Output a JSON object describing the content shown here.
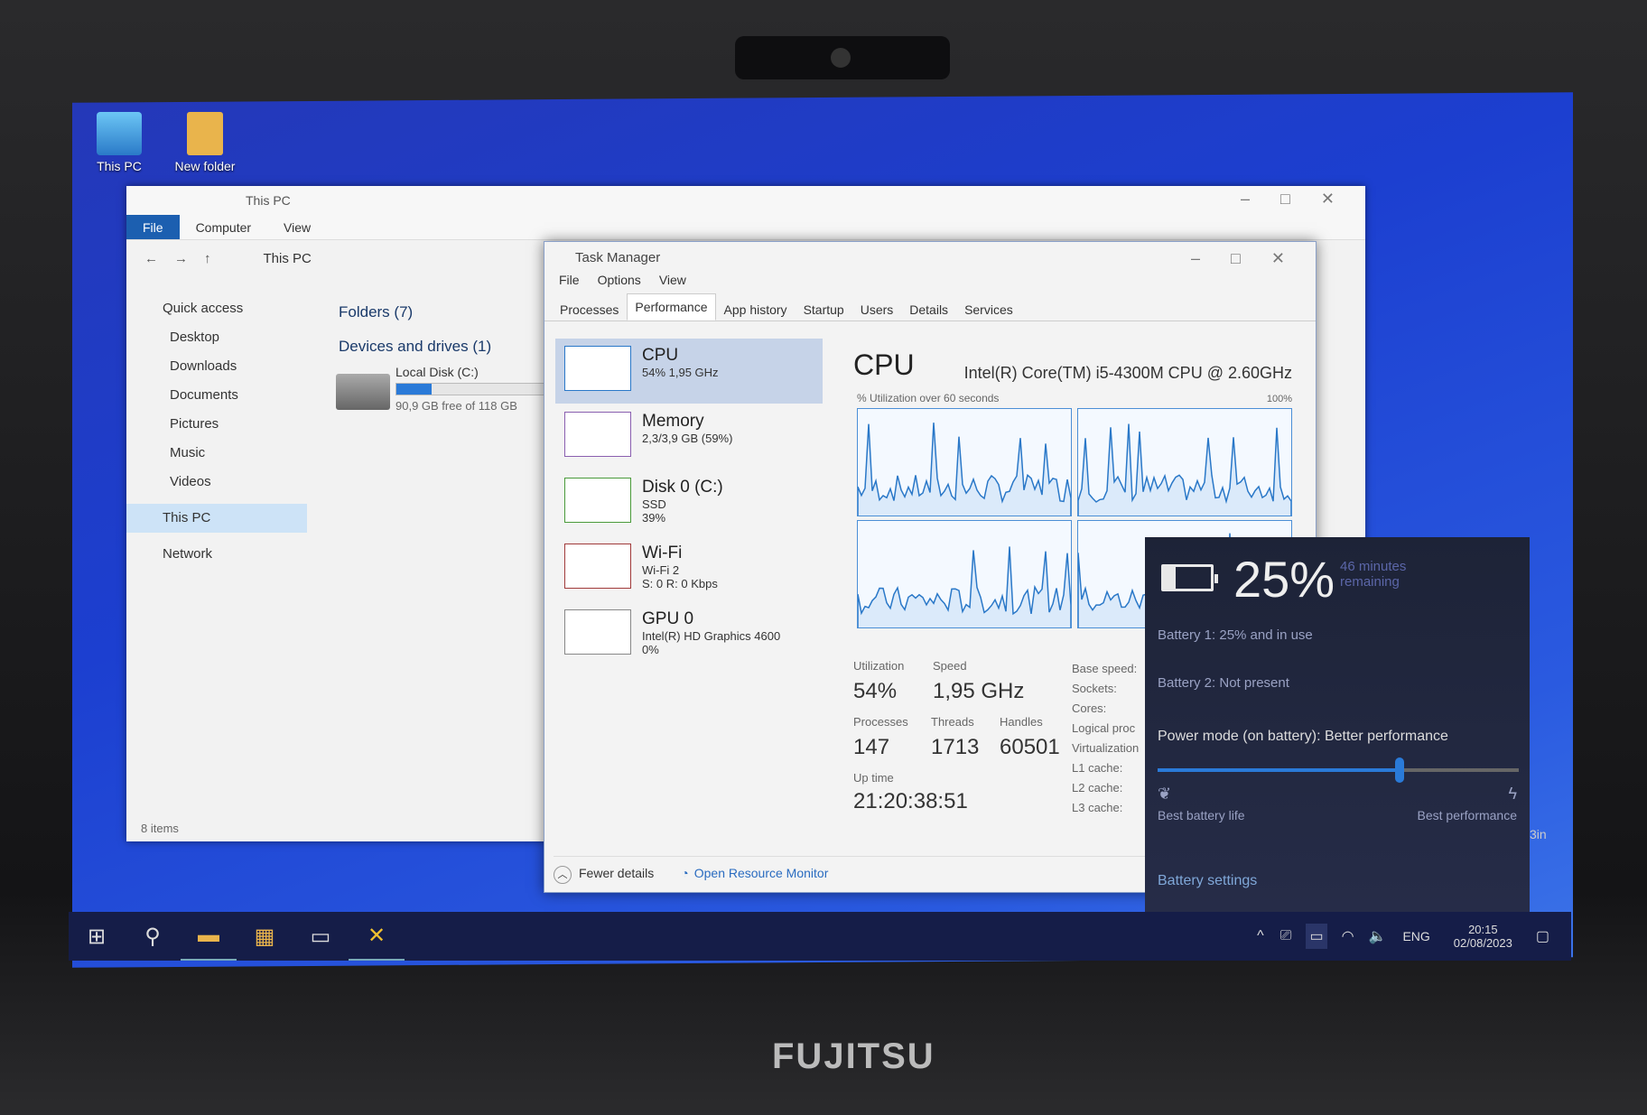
{
  "desktop": {
    "icons": [
      {
        "label": "This PC",
        "icon": "computer-icon"
      },
      {
        "label": "New folder",
        "icon": "folder-icon"
      }
    ]
  },
  "explorer": {
    "title": "This PC",
    "ribbon": [
      "File",
      "Computer",
      "View"
    ],
    "address": "This PC",
    "nav": [
      {
        "label": "Quick access",
        "icon": "star-icon"
      },
      {
        "label": "Desktop",
        "pinned": true
      },
      {
        "label": "Downloads",
        "pinned": true
      },
      {
        "label": "Documents",
        "pinned": true
      },
      {
        "label": "Pictures",
        "pinned": true
      },
      {
        "label": "Music"
      },
      {
        "label": "Videos"
      },
      {
        "label": "This PC",
        "selected": true
      },
      {
        "label": "Network"
      }
    ],
    "folders": "Folders (7)",
    "devices": "Devices and drives (1)",
    "disk": {
      "name": "Local Disk (C:)",
      "free": "90,9 GB free of 118 GB",
      "used_fraction": 0.23
    },
    "status": "8 items"
  },
  "taskmanager": {
    "title": "Task Manager",
    "menu": [
      "File",
      "Options",
      "View"
    ],
    "tabs": [
      "Processes",
      "Performance",
      "App history",
      "Startup",
      "Users",
      "Details",
      "Services"
    ],
    "active_tab": "Performance",
    "resources": [
      {
        "name": "CPU",
        "l1": "54% 1,95 GHz",
        "l2": "",
        "l3": ""
      },
      {
        "name": "Memory",
        "l1": "2,3/3,9 GB (59%)",
        "l2": "",
        "l3": ""
      },
      {
        "name": "Disk 0 (C:)",
        "l1": "SSD",
        "l2": "39%",
        "l3": ""
      },
      {
        "name": "Wi-Fi",
        "l1": "Wi-Fi 2",
        "l2": "S: 0 R: 0 Kbps",
        "l3": ""
      },
      {
        "name": "GPU 0",
        "l1": "Intel(R) HD Graphics 4600",
        "l2": "0%",
        "l3": ""
      }
    ],
    "cpu": {
      "title": "CPU",
      "model": "Intel(R) Core(TM) i5-4300M CPU @ 2.60GHz",
      "graph_label": "% Utilization over 60 seconds",
      "graph_max": "100%",
      "stats": {
        "utilization_label": "Utilization",
        "utilization": "54%",
        "speed_label": "Speed",
        "speed": "1,95 GHz",
        "processes_label": "Processes",
        "processes": "147",
        "threads_label": "Threads",
        "threads": "1713",
        "handles_label": "Handles",
        "handles": "60501",
        "uptime_label": "Up time",
        "uptime": "21:20:38:51"
      },
      "specs": [
        "Base speed:",
        "Sockets:",
        "Cores:",
        "Logical proc",
        "Virtualization",
        "L1 cache:",
        "L2 cache:",
        "L3 cache:"
      ]
    },
    "footer": {
      "fewer": "Fewer details",
      "monitor": "Open Resource Monitor"
    }
  },
  "battery": {
    "percent": "25%",
    "remaining": "46 minutes remaining",
    "battery1": "Battery 1: 25% and in use",
    "battery2": "Battery 2: Not present",
    "power_mode": "Power mode (on battery): Better performance",
    "slider_fraction": 0.67,
    "left_label": "Best battery life",
    "right_label": "Best performance",
    "settings": "Battery settings",
    "accent": "#2a7ad8"
  },
  "taskbar": {
    "lang": "ENG",
    "time": "20:15",
    "date": "02/08/2023"
  },
  "brand": "FUJITSU",
  "behind_text": "3in"
}
